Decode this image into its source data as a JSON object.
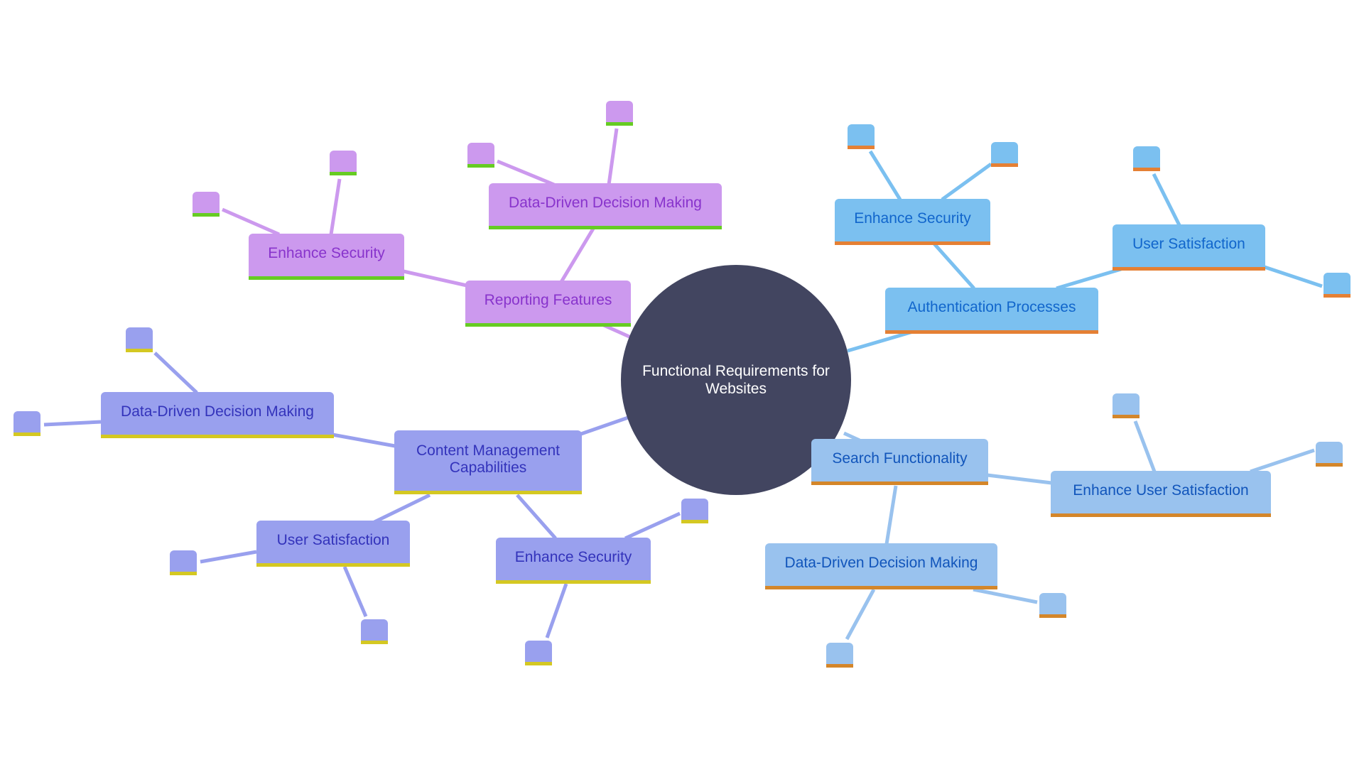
{
  "diagram": {
    "type": "mindmap",
    "root": {
      "label": "Functional Requirements for Websites",
      "color": "#424560"
    },
    "palette": {
      "purple": {
        "fill": "#CC99EE",
        "text": "#8833CC",
        "accent": "#66CC22"
      },
      "blue": {
        "fill": "#7BC0F0",
        "text": "#1166CC",
        "accent": "#E58034"
      },
      "lblue": {
        "fill": "#99C2EE",
        "text": "#1155BB",
        "accent": "#D4862A"
      },
      "indigo": {
        "fill": "#99A0EE",
        "text": "#3333BB",
        "accent": "#D4C822"
      }
    },
    "branches": [
      {
        "label": "Reporting Features",
        "children": [
          {
            "label": "Enhance Security",
            "leaf_count": 2
          },
          {
            "label": "Data-Driven Decision Making",
            "leaf_count": 2
          }
        ]
      },
      {
        "label": "Authentication Processes",
        "children": [
          {
            "label": "Enhance Security",
            "leaf_count": 2
          },
          {
            "label": "User Satisfaction",
            "leaf_count": 2
          }
        ]
      },
      {
        "label": "Search Functionality",
        "children": [
          {
            "label": "Enhance User Satisfaction",
            "leaf_count": 2
          },
          {
            "label": "Data-Driven Decision Making",
            "leaf_count": 2
          }
        ]
      },
      {
        "label": "Content Management Capabilities",
        "children": [
          {
            "label": "Data-Driven Decision Making",
            "leaf_count": 2
          },
          {
            "label": "User Satisfaction",
            "leaf_count": 2
          },
          {
            "label": "Enhance Security",
            "leaf_count": 2
          }
        ]
      }
    ]
  }
}
